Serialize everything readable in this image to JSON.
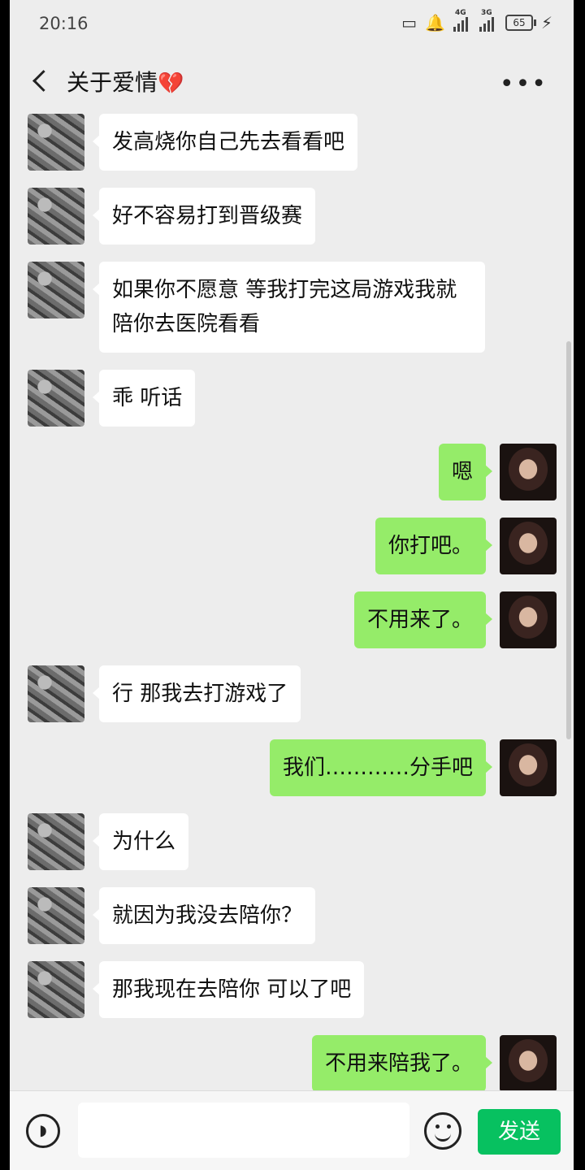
{
  "status_bar": {
    "time": "20:16",
    "net1": "4G",
    "net2": "3G",
    "battery": "65"
  },
  "header": {
    "title": "关于爱情",
    "title_emoji": "💔"
  },
  "messages": [
    {
      "side": "left",
      "text": "发高烧你自己先去看看吧"
    },
    {
      "side": "left",
      "text": "好不容易打到晋级赛"
    },
    {
      "side": "left",
      "text": "如果你不愿意 等我打完这局游戏我就陪你去医院看看"
    },
    {
      "side": "left",
      "text": "乖 听话"
    },
    {
      "side": "right",
      "text": "嗯"
    },
    {
      "side": "right",
      "text": "你打吧。"
    },
    {
      "side": "right",
      "text": "不用来了。"
    },
    {
      "side": "left",
      "text": "行 那我去打游戏了"
    },
    {
      "side": "right",
      "text": "我们…………分手吧"
    },
    {
      "side": "left",
      "text": "为什么"
    },
    {
      "side": "left",
      "text": "就因为我没去陪你？"
    },
    {
      "side": "left",
      "text": "那我现在去陪你 可以了吧"
    },
    {
      "side": "right",
      "text": "不用来陪我了。"
    }
  ],
  "input_bar": {
    "input_value": "",
    "send_label": "发送"
  },
  "colors": {
    "self_bubble": "#95ec69",
    "other_bubble": "#ffffff",
    "send_button": "#07c160",
    "background": "#ededed"
  }
}
